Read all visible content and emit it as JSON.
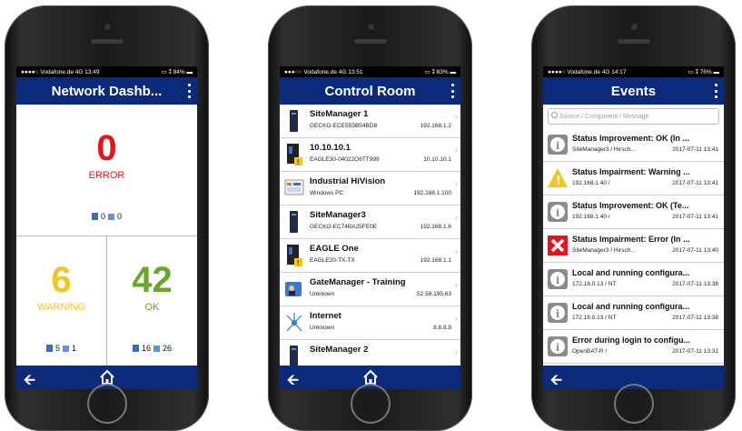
{
  "status_bars": [
    {
      "carrier": "●●●●○ Vodafone.de  4G  13:49",
      "right": "▭ ⁑ 84% ▬"
    },
    {
      "carrier": "●●●○○ Vodafone.de  4G  13:51",
      "right": "▭ ⁑ 83% ▬"
    },
    {
      "carrier": "●●●●○ Vodafone.de  4G  14:17",
      "right": "▭ ⁑ 76% ▬"
    }
  ],
  "dashboard": {
    "title": "Network Dashb...",
    "error": {
      "count": "0",
      "label": "ERROR",
      "mini_a": "0",
      "mini_b": "0"
    },
    "warning": {
      "count": "6",
      "label": "WARNING",
      "mini_a": "5",
      "mini_b": "1"
    },
    "ok": {
      "count": "42",
      "label": "OK",
      "mini_a": "16",
      "mini_b": "26"
    }
  },
  "control_room": {
    "title": "Control Room",
    "items": [
      {
        "title": "SiteManager 1",
        "sub": "GECKO-ECE555B54BD8",
        "ip": "192.168.1.2",
        "icon": "site-manager-icon"
      },
      {
        "title": "10.10.10.1",
        "sub": "EAGLE30-04022O6TT999",
        "ip": "10.10.10.1",
        "icon": "eagle-device-icon"
      },
      {
        "title": "Industrial HiVision",
        "sub": "Windows PC",
        "ip": "192.168.1.100",
        "icon": "hivision-icon"
      },
      {
        "title": "SiteManager3",
        "sub": "GECKO-EC74BA25FE0E",
        "ip": "192.168.1.6",
        "icon": "site-manager-icon"
      },
      {
        "title": "EAGLE One",
        "sub": "EAGLE20-TX-TX",
        "ip": "192.168.1.1",
        "icon": "eagle-device-icon"
      },
      {
        "title": "GateManager - Training",
        "sub": "Unknown",
        "ip": "52.58.195.63",
        "icon": "gatemanager-icon"
      },
      {
        "title": "Internet",
        "sub": "Unknown",
        "ip": "8.8.8.8",
        "icon": "internet-icon"
      },
      {
        "title": "SiteManager 2",
        "sub": "",
        "ip": "",
        "icon": "site-manager-icon"
      }
    ]
  },
  "events": {
    "title": "Events",
    "search_placeholder": "Source / Component / Message",
    "items": [
      {
        "title": "Status Improvement: OK (In ...",
        "source": "SiteManager3 / Hirsch...",
        "time": "2017-07-11 13:41",
        "kind": "info"
      },
      {
        "title": "Status Impairment: Warning ...",
        "source": "192.168.1.40 /",
        "time": "2017-07-11 13:41",
        "kind": "warning"
      },
      {
        "title": "Status Improvement: OK (Te...",
        "source": "192.168.1.40 /",
        "time": "2017-07-11 13:41",
        "kind": "info"
      },
      {
        "title": "Status Impairment: Error (In ...",
        "source": "SiteManager3 / Hirsch...",
        "time": "2017-07-11 13:40",
        "kind": "error"
      },
      {
        "title": "Local and running configura...",
        "source": "172.16.0.13 / NT",
        "time": "2017-07-11 13:38",
        "kind": "info"
      },
      {
        "title": "Local and running configura...",
        "source": "172.16.0.13 / NT",
        "time": "2017-07-11 13:38",
        "kind": "info"
      },
      {
        "title": "Error during login to configu...",
        "source": "OpenBAT-R /",
        "time": "2017-07-11 13:31",
        "kind": "info"
      }
    ]
  },
  "colors": {
    "appbar": "#0b2a7a",
    "error": "#e5141b",
    "warning": "#f3c520",
    "ok": "#6aa52c"
  }
}
